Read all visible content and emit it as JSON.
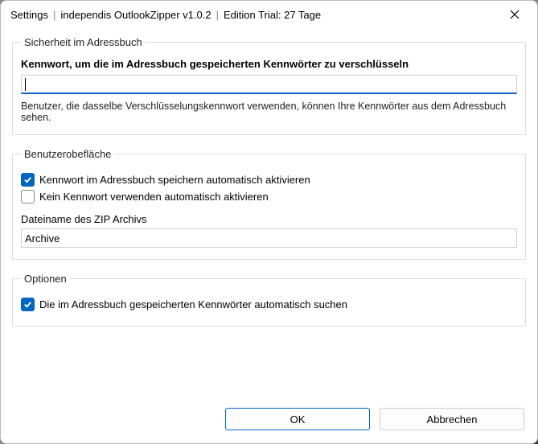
{
  "titlebar": {
    "settings": "Settings",
    "app": "independis OutlookZipper v1.0.2",
    "edition": "Edition Trial: 27 Tage"
  },
  "group_security": {
    "legend": "Sicherheit im Adressbuch",
    "password_label": "Kennwort, um die im Adressbuch gespeicherten Kennwörter zu verschlüsseln",
    "password_value": "",
    "hint": "Benutzer, die dasselbe Verschlüsselungskennwort verwenden, können Ihre Kennwörter aus dem Adressbuch sehen."
  },
  "group_ui": {
    "legend": "Benutzerobefläche",
    "cb_store_pw": "Kennwort im Adressbuch speichern automatisch aktivieren",
    "cb_no_pw": "Kein Kennwort verwenden automatisch aktivieren",
    "zip_label": "Dateiname des ZIP Archivs",
    "zip_value": "Archive"
  },
  "group_options": {
    "legend": "Optionen",
    "cb_autosearch": "Die im Adressbuch gespeicherten Kennwörter automatisch suchen"
  },
  "buttons": {
    "ok": "OK",
    "cancel": "Abbrechen"
  }
}
